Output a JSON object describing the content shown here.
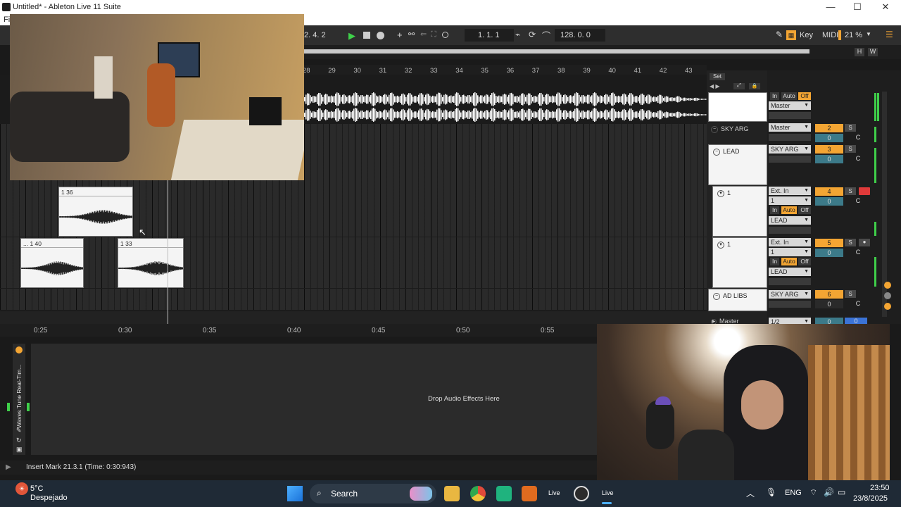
{
  "window": {
    "title": "Untitled* - Ableton Live 11 Suite",
    "minimize": "—",
    "maximize": "☐",
    "close": "✕",
    "menu_first": "Fi"
  },
  "transport": {
    "arrangement_pos": "2.  4.  2",
    "loop_start": "1.  1.  1",
    "tempo": "128.  0.  0",
    "key_label": "Key",
    "midi_label": "MIDI",
    "cpu": "21 %"
  },
  "overview": {
    "h": "H",
    "w": "W"
  },
  "ruler": {
    "bars": [
      "28",
      "29",
      "30",
      "31",
      "32",
      "33",
      "34",
      "35",
      "36",
      "37",
      "38",
      "39",
      "40",
      "41",
      "42",
      "43"
    ],
    "set_label": "Set"
  },
  "clips": [
    {
      "label": "1 36"
    },
    {
      "label": "... 1 40"
    },
    {
      "label": "1 33"
    }
  ],
  "tracks": [
    {
      "name": "SKY ARG"
    },
    {
      "name": "LEAD"
    },
    {
      "name": "1"
    },
    {
      "name": "1"
    },
    {
      "name": "AD LIBS"
    },
    {
      "name": "Master"
    }
  ],
  "io": {
    "master_in": "In",
    "master_auto": "Auto",
    "master_off": "Off",
    "master_route": "Master",
    "sky_route": "Master",
    "lead_route": "SKY ARG",
    "t1_in": "Ext. In",
    "t1_ch": "1",
    "t1_mon_in": "In",
    "t1_mon_auto": "Auto",
    "t1_mon_off": "Off",
    "t1_out": "LEAD",
    "t2_in": "Ext. In",
    "t2_ch": "1",
    "t2_mon_in": "In",
    "t2_mon_auto": "Auto",
    "t2_mon_off": "Off",
    "t2_out": "LEAD",
    "ad_route": "SKY ARG",
    "master_out": "1/2"
  },
  "mixer": [
    {
      "num": "2",
      "vol": "0",
      "solo": "S",
      "pan": "C"
    },
    {
      "num": "3",
      "vol": "0",
      "solo": "S",
      "pan": "C"
    },
    {
      "num": "4",
      "vol": "0",
      "solo": "S",
      "pan": "C"
    },
    {
      "num": "5",
      "vol": "0",
      "solo": "S",
      "pan": "C"
    },
    {
      "num": "6",
      "vol": "0",
      "solo": "S",
      "pan": "C"
    },
    {
      "num": "0",
      "vol": "0"
    }
  ],
  "timeruler": {
    "labels": [
      "0:25",
      "0:30",
      "0:35",
      "0:40",
      "0:45",
      "0:50",
      "0:55"
    ]
  },
  "device": {
    "name": "Waves Tune Real-Tim...",
    "drop_text": "Drop Audio Effects Here"
  },
  "status": {
    "text": "Insert Mark 21.3.1 (Time: 0:30:943)"
  },
  "taskbar": {
    "temp": "5°C",
    "weather": "Despejado",
    "search": "Search",
    "live_label": "Live",
    "live_label2": "Live",
    "lang": "ENG",
    "time": "23:50",
    "date": "23/8/2025"
  },
  "colors": {
    "accent": "#f3a533",
    "play": "#3fd14a",
    "cyan": "#3c7a89",
    "arm": "#e03a3a"
  }
}
